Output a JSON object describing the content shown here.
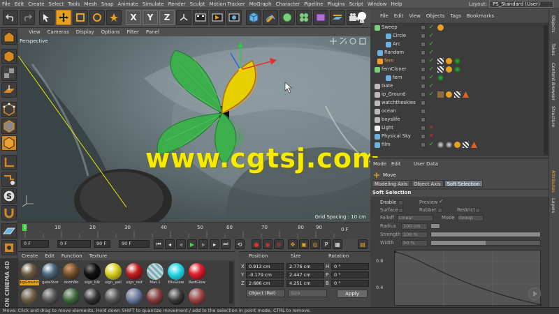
{
  "menubar": {
    "items": [
      "File",
      "Edit",
      "Create",
      "Select",
      "Tools",
      "Mesh",
      "Snap",
      "Animate",
      "Simulate",
      "Render",
      "Sculpt",
      "Motion Tracker",
      "MoGraph",
      "Character",
      "Pipeline",
      "Plugins",
      "Script",
      "Window",
      "Help"
    ],
    "layout_label": "Layout:",
    "layout_value": "PS_Standard (User)"
  },
  "toolbar": {
    "axis_x": "X",
    "axis_y": "Y",
    "axis_z": "Z"
  },
  "viewport": {
    "menu": [
      "View",
      "Cameras",
      "Display",
      "Options",
      "Filter",
      "Panel"
    ],
    "label": "Perspective",
    "grid_spacing": "Grid Spacing : 10 cm"
  },
  "timeline": {
    "ticks": [
      "0",
      "10",
      "20",
      "30",
      "40",
      "50",
      "60",
      "70",
      "80",
      "90"
    ],
    "end_frame": "0 F",
    "fields": [
      "0 F",
      "0 F",
      "90 F",
      "90 F"
    ]
  },
  "materials": {
    "menu": [
      "Create",
      "Edit",
      "Function",
      "Texture"
    ],
    "items": [
      {
        "label": "bgGround",
        "color": "#6b5a40",
        "selected": true
      },
      {
        "label": "gateStor",
        "color": "#4a6a80",
        "selected": false
      },
      {
        "label": "doorWo",
        "color": "#6a4a2a",
        "selected": false
      },
      {
        "label": "sign_blk",
        "color": "#111111",
        "selected": false
      },
      {
        "label": "sign_yell",
        "color": "#d8d020",
        "selected": false
      },
      {
        "label": "sign_red",
        "color": "#c02020",
        "selected": false
      },
      {
        "label": "Mat.1",
        "color": "#9a9a9a",
        "selected": false
      },
      {
        "label": "BluGlow",
        "color": "#20d0e0",
        "selected": false
      },
      {
        "label": "RedGlow",
        "color": "#e02030",
        "selected": false
      }
    ]
  },
  "coords": {
    "col_position": "Position",
    "col_size": "Size",
    "col_rotation": "Rotation",
    "rows": [
      {
        "axis": "X",
        "pos": "0.913 cm",
        "size": "2.776 cm",
        "rot_axis": "H",
        "rot": "0 °"
      },
      {
        "axis": "Y",
        "pos": "-0.179 cm",
        "size": "2.447 cm",
        "rot_axis": "P",
        "rot": "0 °"
      },
      {
        "axis": "Z",
        "pos": "2.686 cm",
        "size": "4.251 cm",
        "rot_axis": "B",
        "rot": "0 °"
      }
    ],
    "mode": "Object (Rel)",
    "size_mode": "Size",
    "apply": "Apply"
  },
  "side_logo": "MAXON CINEMA 4D",
  "status": "Move: Click and drag to move elements. Hold down SHIFT to quantize movement / add to the selection in point mode, CTRL to remove.",
  "object_manager": {
    "menu": [
      "File",
      "Edit",
      "View",
      "Objects",
      "Tags",
      "Bookmarks"
    ],
    "objects": [
      {
        "name": "Sweep",
        "indent": 0,
        "icon": "#7ad07a",
        "selected": false
      },
      {
        "name": "Circle",
        "indent": 1,
        "icon": "#6ab0e0",
        "selected": false
      },
      {
        "name": "Arc",
        "indent": 1,
        "icon": "#6ab0e0",
        "selected": false
      },
      {
        "name": "Random",
        "indent": 0,
        "icon": "#6ab0e0",
        "selected": false
      },
      {
        "name": "fern",
        "indent": 0,
        "icon": "#f0a030",
        "selected": true
      },
      {
        "name": "fernCloner",
        "indent": 0,
        "icon": "#7ad07a",
        "selected": false
      },
      {
        "name": "fern",
        "indent": 1,
        "icon": "#6ab0e0",
        "selected": false
      },
      {
        "name": "Gate",
        "indent": 0,
        "icon": "#bbbbbb",
        "selected": false
      },
      {
        "name": "ip_Ground",
        "indent": 0,
        "icon": "#bbbbbb",
        "selected": false
      },
      {
        "name": "watchtheskies",
        "indent": 0,
        "icon": "#bbbbbb",
        "selected": false
      },
      {
        "name": "ocean",
        "indent": 0,
        "icon": "#bbbbbb",
        "selected": false
      },
      {
        "name": "boyslife",
        "indent": 0,
        "icon": "#bbbbbb",
        "selected": false
      },
      {
        "name": "Light",
        "indent": 0,
        "icon": "#eeeeee",
        "selected": false
      },
      {
        "name": "Physical Sky",
        "indent": 0,
        "icon": "#6ab0e0",
        "selected": false
      },
      {
        "name": "film",
        "indent": 0,
        "icon": "#6ab0e0",
        "selected": false
      }
    ]
  },
  "right_tabs": [
    "Objects",
    "Takes",
    "Content Browser",
    "Structure",
    "Attributes",
    "Layers"
  ],
  "attributes": {
    "mode_menu": "Mode",
    "edit_menu": "Edit",
    "user_data_menu": "User Data",
    "object_name": "Move",
    "tabs": [
      "Modeling Axis",
      "Object Axis",
      "Soft Selection"
    ],
    "section_title": "Soft Selection",
    "enable": "Enable",
    "preview": "Preview",
    "surface": "Surface",
    "rubber": "Rubber",
    "restrict": "Restrict",
    "falloff_label": "Falloff",
    "falloff_value": "Linear",
    "mode_label": "Mode",
    "mode_value": "Group",
    "radius_label": "Radius",
    "radius_value": "100 cm",
    "strength_label": "Strength",
    "strength_value": "100 %",
    "strength_level": 1.0,
    "width_label": "Width",
    "width_value": "50 %",
    "width_level": 0.5,
    "graph_label_top": "0.8",
    "graph_label_bottom": "0.4"
  },
  "watermark": "www.cgtsj.com"
}
